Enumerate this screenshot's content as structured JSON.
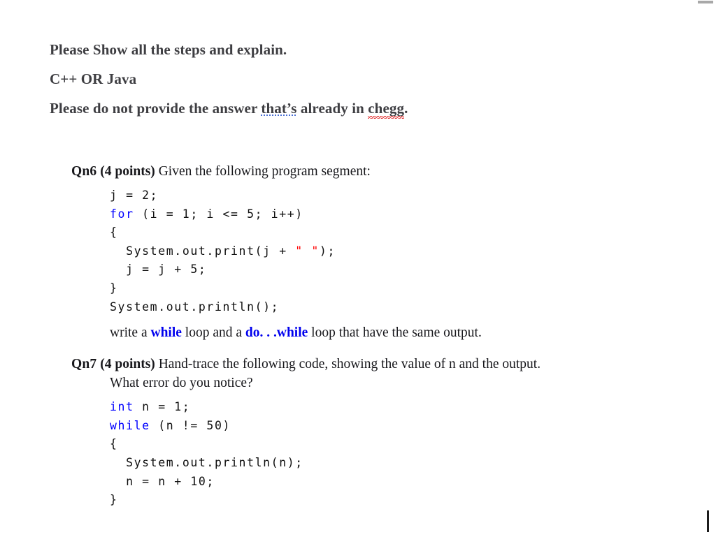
{
  "document": {
    "request": {
      "lines": [
        {
          "id": "l1",
          "text": "Please Show all the steps and explain."
        },
        {
          "id": "l2",
          "text": "C++ OR Java"
        }
      ],
      "line3": {
        "before": "Please do not provide the answer ",
        "grammar_flagged": "that’s",
        "middle": " already in ",
        "spell_flagged": "chegg",
        "after": "."
      }
    },
    "questions": [
      {
        "label": "Qn6",
        "points": "(4 points)",
        "prompt": "Given the following program segment:",
        "code": [
          {
            "indent": "",
            "segments": [
              {
                "t": "j = 2;",
                "c": "plain"
              }
            ]
          },
          {
            "indent": "",
            "segments": [
              {
                "t": "for",
                "c": "kw"
              },
              {
                "t": " (i = 1; i <= 5; i++)",
                "c": "plain"
              }
            ]
          },
          {
            "indent": "",
            "segments": [
              {
                "t": "{",
                "c": "plain"
              }
            ]
          },
          {
            "indent": "  ",
            "segments": [
              {
                "t": "System.out.print(j + ",
                "c": "plain"
              },
              {
                "t": "\" \"",
                "c": "str"
              },
              {
                "t": ");",
                "c": "plain"
              }
            ]
          },
          {
            "indent": "  ",
            "segments": [
              {
                "t": "j = j + 5;",
                "c": "plain"
              }
            ]
          },
          {
            "indent": "",
            "segments": [
              {
                "t": "}",
                "c": "plain"
              }
            ]
          },
          {
            "indent": "",
            "segments": [
              {
                "t": "System.out.println();",
                "c": "plain"
              }
            ]
          }
        ],
        "note": {
          "a": "write a ",
          "kw1": "while",
          "b": " loop and a ",
          "kw2": "do. . .while",
          "c": " loop that have the same output."
        }
      },
      {
        "label": "Qn7",
        "points": "(4 points)",
        "prompt": "Hand-trace the following code, showing the value of n and the output.",
        "prompt_line2": "What error do you notice?",
        "code": [
          {
            "indent": "",
            "segments": [
              {
                "t": "int",
                "c": "kw"
              },
              {
                "t": " n = 1;",
                "c": "plain"
              }
            ]
          },
          {
            "indent": "",
            "segments": [
              {
                "t": "while",
                "c": "kw"
              },
              {
                "t": " (n != 50)",
                "c": "plain"
              }
            ]
          },
          {
            "indent": "",
            "segments": [
              {
                "t": "{",
                "c": "plain"
              }
            ]
          },
          {
            "indent": "  ",
            "segments": [
              {
                "t": "System.out.println(n);",
                "c": "plain"
              }
            ]
          },
          {
            "indent": "  ",
            "segments": [
              {
                "t": "n = n + 10;",
                "c": "plain"
              }
            ]
          },
          {
            "indent": "",
            "segments": [
              {
                "t": "}",
                "c": "plain"
              }
            ]
          }
        ]
      }
    ]
  },
  "colors": {
    "keyword_blue": "#0000ff",
    "string_red": "#ff0000",
    "body_text": "#17171b",
    "header_text": "#3e3e42",
    "spellcheck_red": "#e02020",
    "grammarcheck_blue": "#4a6fd4",
    "caret": "#1c1c1c",
    "scrollbar": "#a8a8a8"
  }
}
